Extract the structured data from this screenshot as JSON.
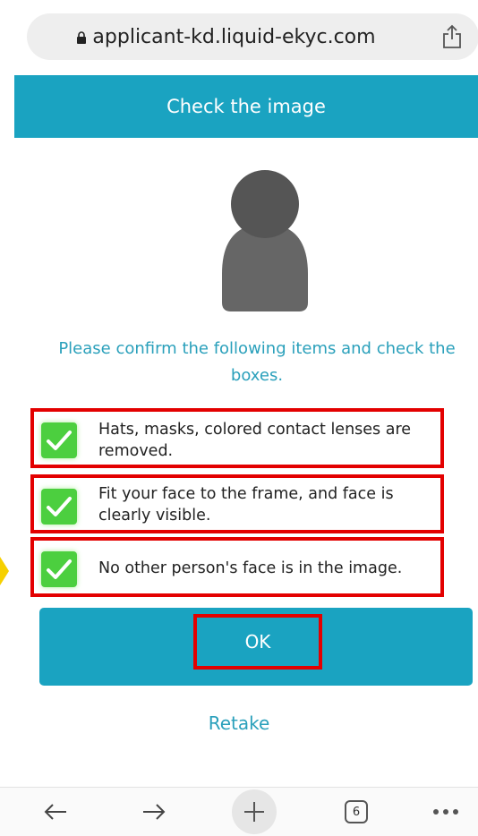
{
  "browser": {
    "url": "applicant-kd.liquid-ekyc.com",
    "tab_count": "6"
  },
  "header": {
    "title": "Check the image"
  },
  "instructions": "Please confirm the following items and check the boxes.",
  "checklist": [
    {
      "text": "Hats, masks, colored contact lenses are removed.",
      "checked": true
    },
    {
      "text": "Fit your face to the frame, and face is clearly visible.",
      "checked": true
    },
    {
      "text": "No other person's face is in the image.",
      "checked": true
    }
  ],
  "actions": {
    "ok_label": "OK",
    "retake_label": "Retake"
  },
  "colors": {
    "accent": "#1aa3c1",
    "check": "#4ccf3f",
    "highlight": "#e30000"
  }
}
